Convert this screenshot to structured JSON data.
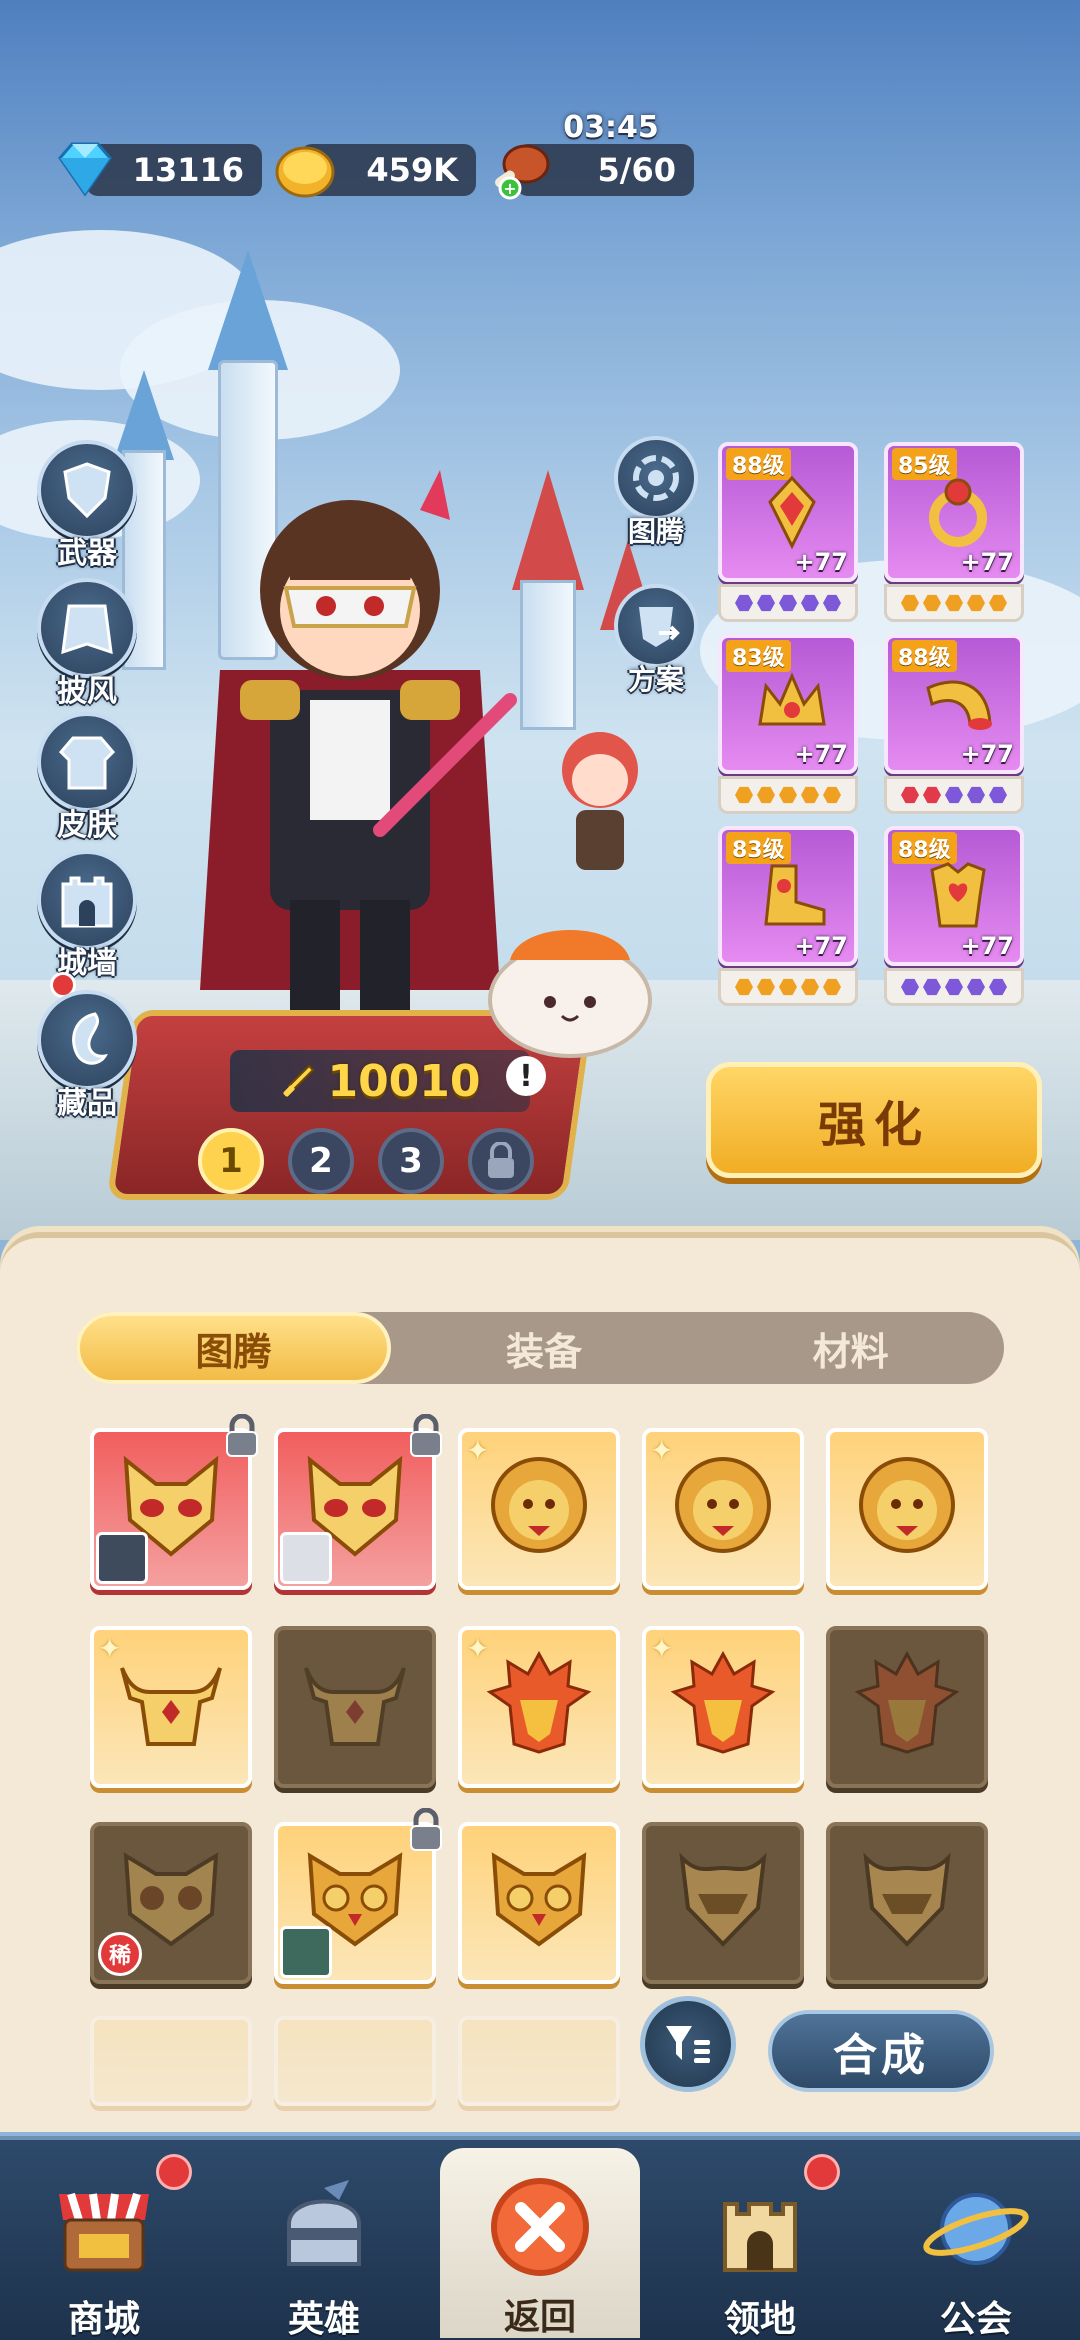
{
  "resources": {
    "gems": "13116",
    "gold": "459K",
    "stamina": "5/60",
    "timer": "03:45"
  },
  "left_nav": [
    {
      "label": "武器",
      "icon": "weapon-icon"
    },
    {
      "label": "披风",
      "icon": "cape-icon"
    },
    {
      "label": "皮肤",
      "icon": "skin-icon"
    },
    {
      "label": "城墙",
      "icon": "wall-icon"
    },
    {
      "label": "藏品",
      "icon": "collection-icon"
    }
  ],
  "mid_nav": [
    {
      "label": "图腾",
      "icon": "totem-icon"
    },
    {
      "label": "方案",
      "icon": "preset-icon"
    }
  ],
  "equipment": [
    {
      "level": "88级",
      "plus": "+77",
      "stars": [
        "p",
        "p",
        "p",
        "p",
        "p"
      ]
    },
    {
      "level": "85级",
      "plus": "+77",
      "stars": [
        "o",
        "o",
        "o",
        "o",
        "o"
      ]
    },
    {
      "level": "83级",
      "plus": "+77",
      "stars": [
        "o",
        "o",
        "o",
        "o",
        "o"
      ]
    },
    {
      "level": "88级",
      "plus": "+77",
      "stars": [
        "r",
        "r",
        "p",
        "p",
        "p"
      ]
    },
    {
      "level": "83级",
      "plus": "+77",
      "stars": [
        "o",
        "o",
        "o",
        "o",
        "o"
      ]
    },
    {
      "level": "88级",
      "plus": "+77",
      "stars": [
        "p",
        "p",
        "p",
        "p",
        "p"
      ]
    }
  ],
  "power": "10010",
  "pages": [
    "1",
    "2",
    "3"
  ],
  "enhance_label": "强化",
  "tabs": [
    "图腾",
    "装备",
    "材料"
  ],
  "combine_label": "合成",
  "rare_label": "稀",
  "bottom_nav": [
    {
      "label": "商城",
      "icon": "shop-icon"
    },
    {
      "label": "英雄",
      "icon": "hero-helmet-icon"
    },
    {
      "label": "返回",
      "icon": "close-icon"
    },
    {
      "label": "领地",
      "icon": "castle-icon"
    },
    {
      "label": "公会",
      "icon": "planet-icon"
    }
  ],
  "colors": {
    "accent_gold": "#f2bb46",
    "epic_purple": "#b65ad6",
    "panel": "#f3e9d6"
  }
}
